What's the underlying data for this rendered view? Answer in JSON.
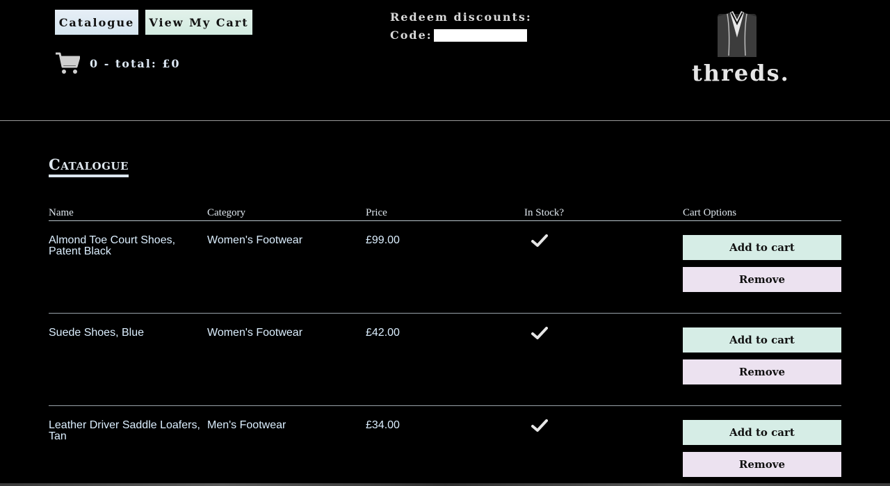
{
  "header": {
    "nav": {
      "catalogue_label": "Catalogue",
      "view_cart_label": "View My Cart"
    },
    "cart_summary": {
      "text": "0 - total: £0"
    },
    "discount": {
      "heading": "Redeem discounts:",
      "code_label": "Code:",
      "code_value": ""
    },
    "logo": {
      "text": "threds."
    }
  },
  "catalogue": {
    "title": "Catalogue",
    "columns": [
      "Name",
      "Category",
      "Price",
      "In Stock?",
      "Cart Options"
    ],
    "rows": [
      {
        "name": "Almond Toe Court Shoes, Patent Black",
        "category": "Women's Footwear",
        "price": "£99.00",
        "in_stock": true,
        "add_label": "Add to cart",
        "remove_label": "Remove"
      },
      {
        "name": "Suede Shoes, Blue",
        "category": "Women's Footwear",
        "price": "£42.00",
        "in_stock": true,
        "add_label": "Add to cart",
        "remove_label": "Remove"
      },
      {
        "name": "Leather Driver Saddle Loafers, Tan",
        "category": "Men's Footwear",
        "price": "£34.00",
        "in_stock": true,
        "add_label": "Add to cart",
        "remove_label": "Remove"
      }
    ]
  },
  "icons": {
    "cart": "shopping-cart-icon",
    "stock": "checkmark-icon",
    "logo": "suit-jacket-icon"
  },
  "colors": {
    "background": "#000000",
    "text": "#dcefff",
    "add_button": "#d6ede6",
    "remove_button": "#ece2f0"
  }
}
